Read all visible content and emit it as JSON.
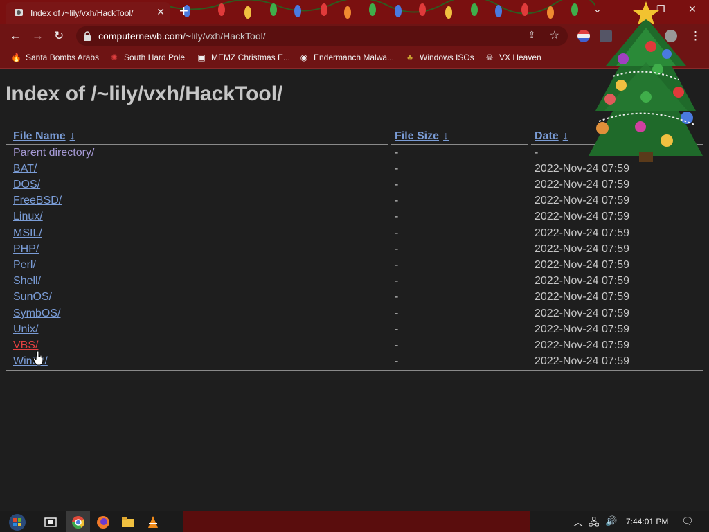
{
  "browser": {
    "tab_title": "Index of /~lily/vxh/HackTool/",
    "tab_close": "✕",
    "new_tab": "+",
    "window_controls": {
      "dropdown": "⌄",
      "minimize": "—",
      "maximize": "❐",
      "close": "✕"
    },
    "nav": {
      "back": "←",
      "forward": "→",
      "reload": "↻"
    },
    "url_domain": "computernewb.com",
    "url_path": "/~lily/vxh/HackTool/",
    "bookmarks": [
      {
        "label": "Santa Bombs Arabs",
        "icon": "fire-icon"
      },
      {
        "label": "South Hard Pole",
        "icon": "virus-icon"
      },
      {
        "label": "MEMZ Christmas E...",
        "icon": "image-icon"
      },
      {
        "label": "Endermanch Malwa...",
        "icon": "raccoon-icon"
      },
      {
        "label": "Windows ISOs",
        "icon": "elf-icon"
      },
      {
        "label": "VX Heaven",
        "icon": "skull-icon"
      }
    ]
  },
  "page": {
    "heading": "Index of /~lily/vxh/HackTool/",
    "columns": {
      "name": "File Name",
      "size": "File Size",
      "date": "Date",
      "sort_arrow": "↓"
    },
    "rows": [
      {
        "name": "Parent directory/",
        "size": "-",
        "date": "-"
      },
      {
        "name": "BAT/",
        "size": "-",
        "date": "2022-Nov-24 07:59"
      },
      {
        "name": "DOS/",
        "size": "-",
        "date": "2022-Nov-24 07:59"
      },
      {
        "name": "FreeBSD/",
        "size": "-",
        "date": "2022-Nov-24 07:59"
      },
      {
        "name": "Linux/",
        "size": "-",
        "date": "2022-Nov-24 07:59"
      },
      {
        "name": "MSIL/",
        "size": "-",
        "date": "2022-Nov-24 07:59"
      },
      {
        "name": "PHP/",
        "size": "-",
        "date": "2022-Nov-24 07:59"
      },
      {
        "name": "Perl/",
        "size": "-",
        "date": "2022-Nov-24 07:59"
      },
      {
        "name": "Shell/",
        "size": "-",
        "date": "2022-Nov-24 07:59"
      },
      {
        "name": "SunOS/",
        "size": "-",
        "date": "2022-Nov-24 07:59"
      },
      {
        "name": "SymbOS/",
        "size": "-",
        "date": "2022-Nov-24 07:59"
      },
      {
        "name": "Unix/",
        "size": "-",
        "date": "2022-Nov-24 07:59"
      },
      {
        "name": "VBS/",
        "size": "-",
        "date": "2022-Nov-24 07:59"
      },
      {
        "name": "Win32/",
        "size": "-",
        "date": "2022-Nov-24 07:59"
      }
    ]
  },
  "taskbar": {
    "clock": "7:44:01 PM",
    "tray": {
      "chevron": "︿",
      "network": "🖧",
      "volume": "🔊",
      "notifications": "🗨"
    }
  },
  "colors": {
    "chrome": "#7a1010",
    "link": "#7a9cd6",
    "visited": "#a69ad6",
    "hover_link": "#e14040",
    "background": "#1e1e1e"
  }
}
